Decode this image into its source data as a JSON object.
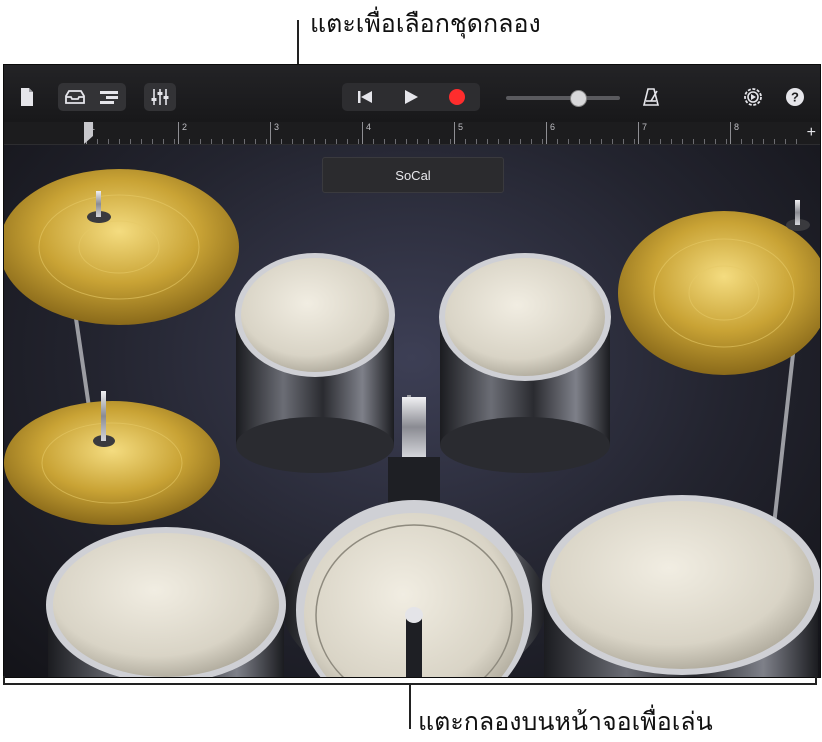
{
  "callouts": {
    "top": "แตะเพื่อเลือกชุดกลอง",
    "bottom": "แตะกลองบนหน้าจอเพื่อเล่น"
  },
  "toolbar": {
    "icons": [
      "document-icon",
      "browser-icon",
      "tracks-view-icon",
      "mixer-icon",
      "go-to-start-icon",
      "play-icon",
      "record-icon",
      "metronome-icon",
      "settings-icon",
      "help-icon"
    ],
    "help_label": "?",
    "volume_level": 0.63,
    "record_color": "#ff2d2d"
  },
  "ruler": {
    "bars": [
      "1",
      "2",
      "3",
      "4",
      "5",
      "6",
      "7",
      "8"
    ],
    "add_label": "+"
  },
  "kit": {
    "name": "SoCal"
  },
  "drums": {
    "cymbal_color": "#c9a335",
    "drumhead_color": "#d9d4c6",
    "shell_color": "#2a2b30"
  }
}
